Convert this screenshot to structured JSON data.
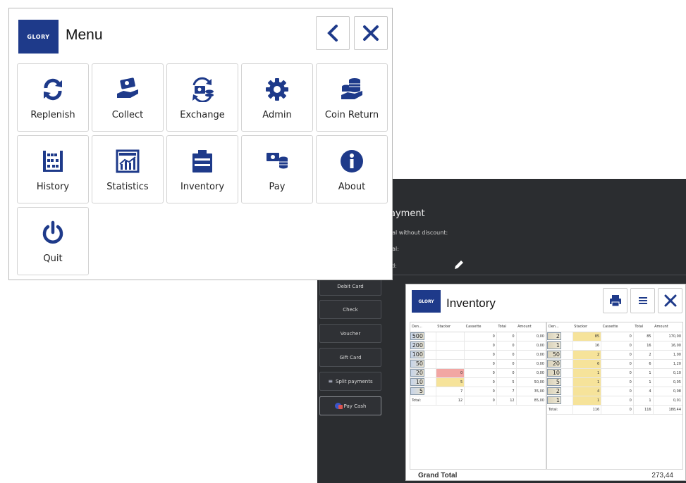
{
  "menu": {
    "logo": "GLORY",
    "title": "Menu",
    "tiles": [
      {
        "label": "Replenish"
      },
      {
        "label": "Collect"
      },
      {
        "label": "Exchange"
      },
      {
        "label": "Admin"
      },
      {
        "label": "Coin Return"
      },
      {
        "label": "History"
      },
      {
        "label": "Statistics"
      },
      {
        "label": "Inventory"
      },
      {
        "label": "Pay"
      },
      {
        "label": "About"
      },
      {
        "label": "Quit"
      }
    ]
  },
  "pos": {
    "title": "ayment",
    "lines": [
      "tal without discount:",
      "tal:",
      "id:"
    ],
    "buttons": [
      "Debit Card",
      "Check",
      "Voucher",
      "Gift Card",
      "Split payments",
      "Pay Cash"
    ]
  },
  "inventory": {
    "logo": "GLORY",
    "title": "Inventory",
    "headers": [
      "Den...",
      "Stacker",
      "Cassette",
      "Total",
      "Amount"
    ],
    "left_rows": [
      {
        "den": "500",
        "stacker": "",
        "cassette": "0",
        "total": "0",
        "amount": "0,00"
      },
      {
        "den": "200",
        "stacker": "",
        "cassette": "0",
        "total": "0",
        "amount": "0,00"
      },
      {
        "den": "100",
        "stacker": "",
        "cassette": "0",
        "total": "0",
        "amount": "0,00"
      },
      {
        "den": "50",
        "stacker": "",
        "cassette": "0",
        "total": "0",
        "amount": "0,00"
      },
      {
        "den": "20",
        "stacker": "0",
        "cassette": "0",
        "total": "0",
        "amount": "0,00"
      },
      {
        "den": "10",
        "stacker": "5",
        "cassette": "0",
        "total": "5",
        "amount": "50,00"
      },
      {
        "den": "5",
        "stacker": "7",
        "cassette": "0",
        "total": "7",
        "amount": "35,00"
      }
    ],
    "left_total": {
      "label": "Total:",
      "stacker": "12",
      "cassette": "0",
      "total": "12",
      "amount": "85,00"
    },
    "right_rows": [
      {
        "den": "2",
        "stacker": "85",
        "cassette": "0",
        "total": "85",
        "amount": "170,00"
      },
      {
        "den": "1",
        "stacker": "16",
        "cassette": "0",
        "total": "16",
        "amount": "16,00"
      },
      {
        "den": "50",
        "stacker": "2",
        "cassette": "0",
        "total": "2",
        "amount": "1,00"
      },
      {
        "den": "20",
        "stacker": "6",
        "cassette": "0",
        "total": "6",
        "amount": "1,20"
      },
      {
        "den": "10",
        "stacker": "1",
        "cassette": "0",
        "total": "1",
        "amount": "0,10"
      },
      {
        "den": "5",
        "stacker": "1",
        "cassette": "0",
        "total": "1",
        "amount": "0,05"
      },
      {
        "den": "2",
        "stacker": "4",
        "cassette": "0",
        "total": "4",
        "amount": "0,08"
      },
      {
        "den": "1",
        "stacker": "1",
        "cassette": "0",
        "total": "1",
        "amount": "0,01"
      }
    ],
    "right_total": {
      "label": "Total:",
      "stacker": "116",
      "cassette": "0",
      "total": "116",
      "amount": "188,44"
    },
    "grand_total_label": "Grand Total",
    "grand_total_value": "273,44"
  },
  "colors": {
    "brand": "#1e3a8a",
    "pos_bg": "#2b2d30",
    "low": "#f2a6a3",
    "warn": "#f6e39a"
  }
}
